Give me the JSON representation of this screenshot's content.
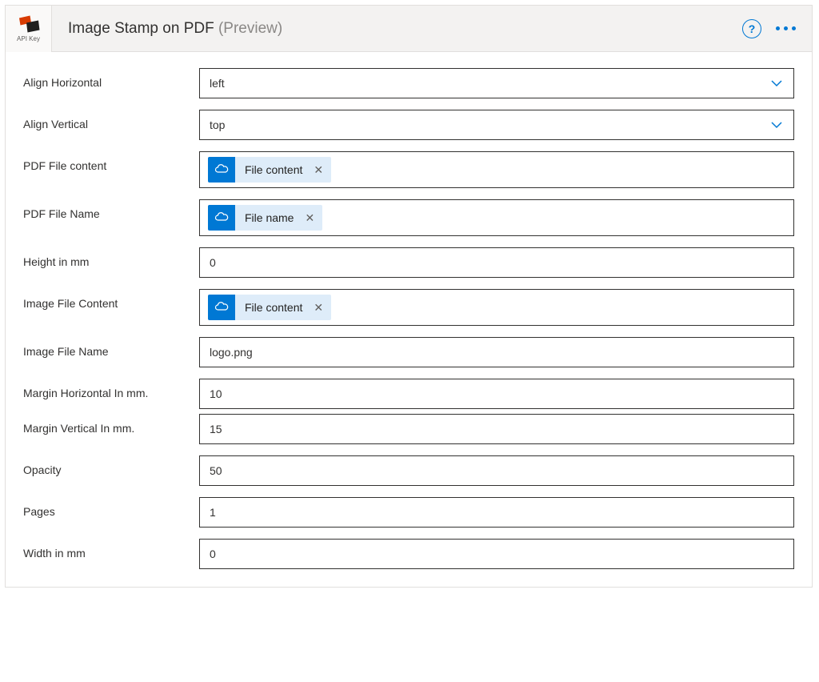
{
  "header": {
    "logo_caption": "API Key",
    "title": "Image Stamp on PDF",
    "title_suffix": "(Preview)",
    "help": "?"
  },
  "fields": {
    "align_horizontal": {
      "label": "Align Horizontal",
      "value": "left"
    },
    "align_vertical": {
      "label": "Align Vertical",
      "value": "top"
    },
    "pdf_content": {
      "label": "PDF File content",
      "token": "File content"
    },
    "pdf_name": {
      "label": "PDF File Name",
      "token": "File name"
    },
    "height": {
      "label": "Height in mm",
      "value": "0"
    },
    "image_content": {
      "label": "Image File Content",
      "token": "File content"
    },
    "image_name": {
      "label": "Image File Name",
      "value": "logo.png"
    },
    "margin_h": {
      "label": "Margin Horizontal In mm.",
      "value": "10"
    },
    "margin_v": {
      "label": "Margin Vertical In mm.",
      "value": "15"
    },
    "opacity": {
      "label": "Opacity",
      "value": "50"
    },
    "pages": {
      "label": "Pages",
      "value": "1"
    },
    "width": {
      "label": "Width in mm",
      "value": "0"
    }
  }
}
